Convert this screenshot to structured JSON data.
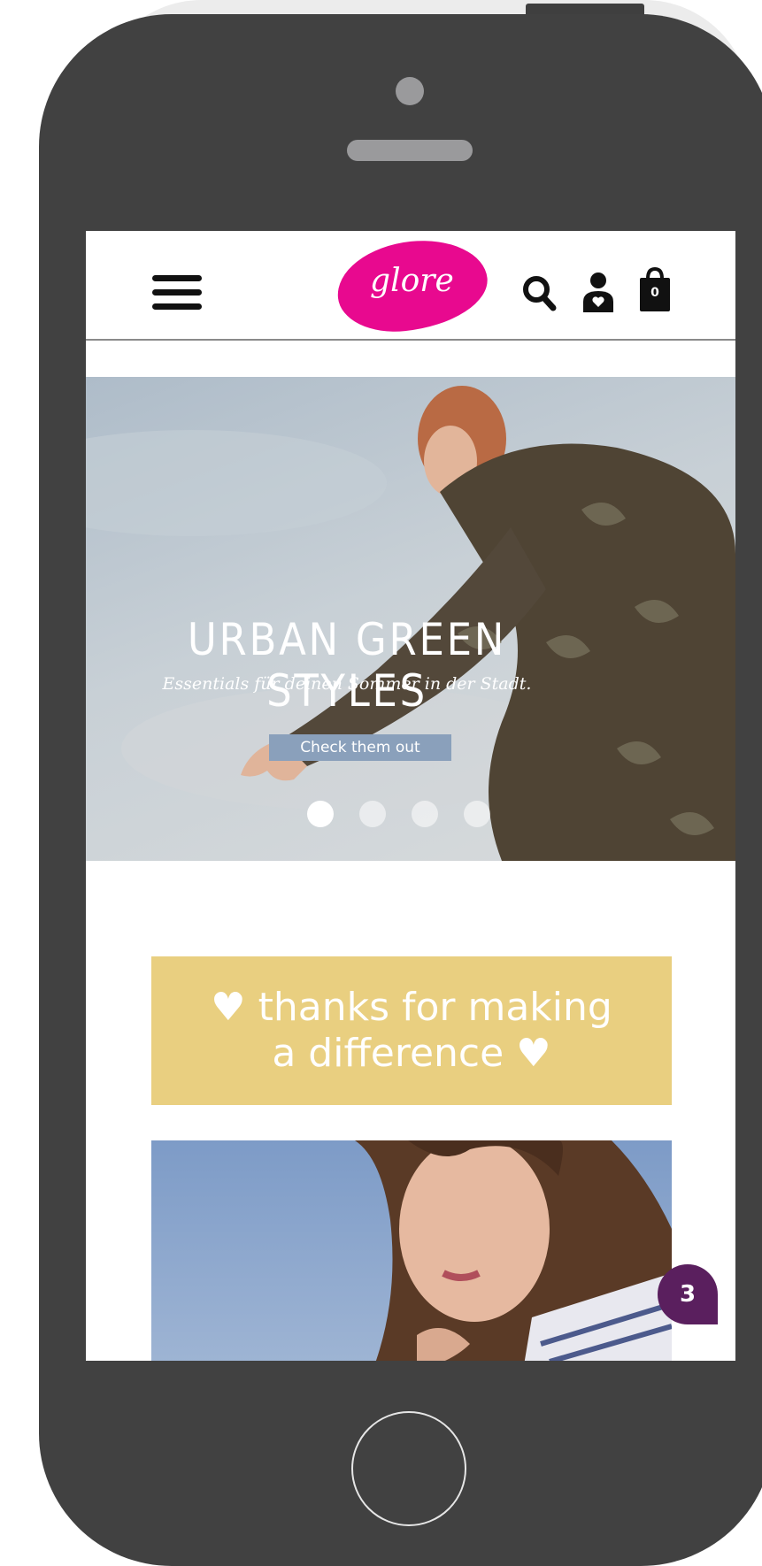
{
  "header": {
    "logo_text": "glore",
    "cart_count": "0"
  },
  "hero": {
    "title": "URBAN GREEN STYLES",
    "subtitle": "Essentials für deinen Sommer in der Stadt.",
    "button_label": "Check them out",
    "slides_total": 4,
    "active_slide": 1
  },
  "banner": {
    "line1": "♥ thanks for making",
    "line2": "a difference ♥"
  },
  "chat": {
    "badge_count": "3"
  },
  "colors": {
    "brand_pink": "#e8098f",
    "banner_yellow": "#e9cf80",
    "button_blue": "#8aa0bb",
    "chat_purple": "#5a1f5e",
    "phone_body": "#414141"
  }
}
